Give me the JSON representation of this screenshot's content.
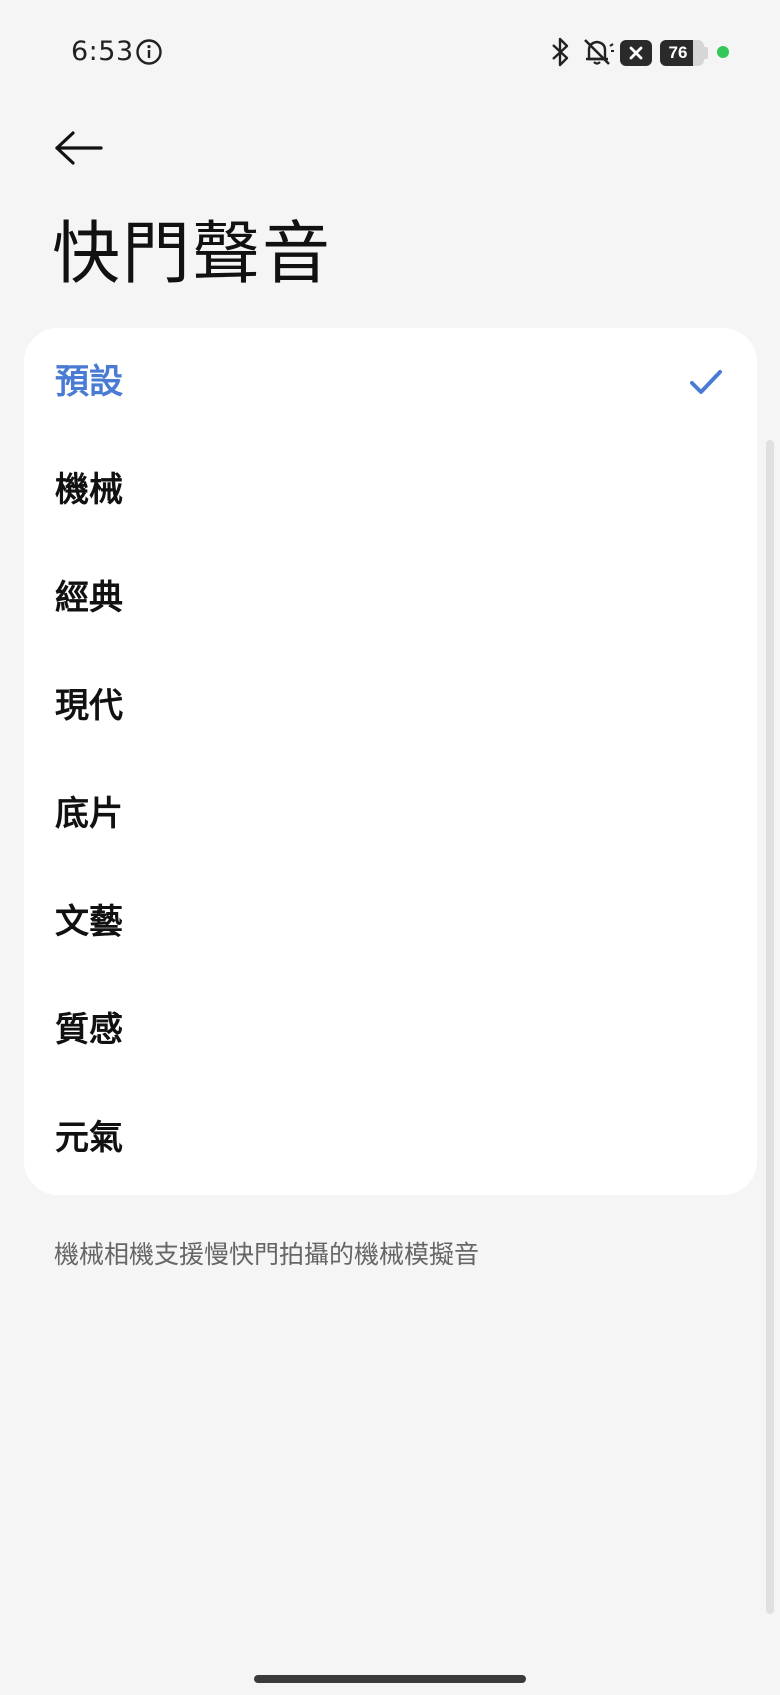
{
  "status_bar": {
    "time": "6:53",
    "battery_level": "76",
    "battery_fraction": 0.76,
    "privacy_indicator_color": "#34c759",
    "icons": [
      "info-icon",
      "bluetooth-icon",
      "mute-icon",
      "no-sim-icon",
      "battery-icon"
    ]
  },
  "header": {
    "back_icon": "back-arrow-icon",
    "title": "快門聲音"
  },
  "options": {
    "selected_index": 0,
    "accent_color": "#4a7bd4",
    "items": [
      {
        "label": "預設",
        "selected": true
      },
      {
        "label": "機械",
        "selected": false
      },
      {
        "label": "經典",
        "selected": false
      },
      {
        "label": "現代",
        "selected": false
      },
      {
        "label": "底片",
        "selected": false
      },
      {
        "label": "文藝",
        "selected": false
      },
      {
        "label": "質感",
        "selected": false
      },
      {
        "label": "元氣",
        "selected": false
      }
    ]
  },
  "footnote": "機械相機支援慢快門拍攝的機械模擬音"
}
